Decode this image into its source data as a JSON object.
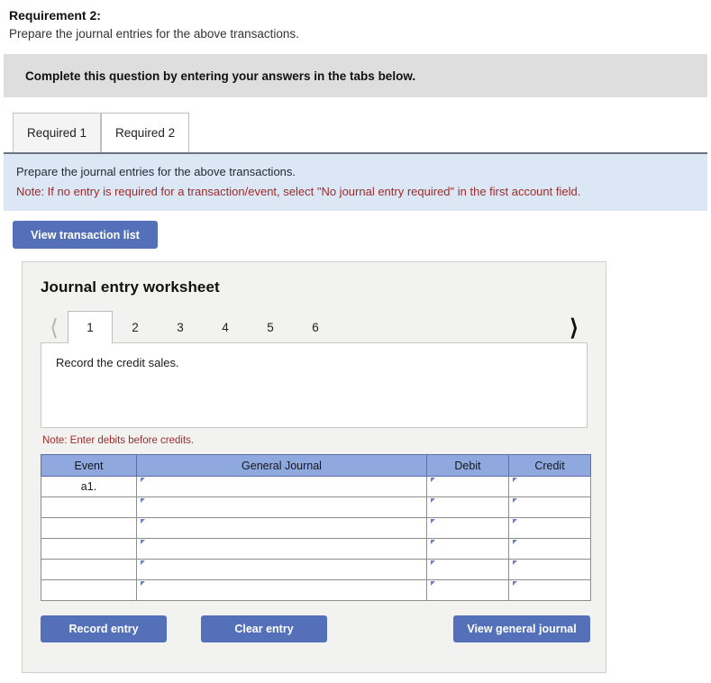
{
  "requirement": {
    "title": "Requirement 2:",
    "subtitle": "Prepare the journal entries for the above transactions."
  },
  "instruction_bar": {
    "text": "Complete this question by entering your answers in the tabs below."
  },
  "tabs": [
    {
      "label": "Required 1",
      "active": false
    },
    {
      "label": "Required 2",
      "active": true
    }
  ],
  "note_panel": {
    "line1": "Prepare the journal entries for the above transactions.",
    "line2": "Note: If no entry is required for a transaction/event, select \"No journal entry required\" in the first account field."
  },
  "view_transaction_list_button": "View transaction list",
  "worksheet": {
    "title": "Journal entry worksheet",
    "prev_icon": "chevron-left-icon",
    "next_icon": "chevron-right-icon",
    "pages": [
      {
        "label": "1",
        "active": true
      },
      {
        "label": "2",
        "active": false
      },
      {
        "label": "3",
        "active": false
      },
      {
        "label": "4",
        "active": false
      },
      {
        "label": "5",
        "active": false
      },
      {
        "label": "6",
        "active": false
      }
    ],
    "description": "Record the credit sales.",
    "debits_note": "Note: Enter debits before credits.",
    "table": {
      "headers": [
        "Event",
        "General Journal",
        "Debit",
        "Credit"
      ],
      "rows": [
        {
          "event": "a1.",
          "general_journal": "",
          "debit": "",
          "credit": ""
        },
        {
          "event": "",
          "general_journal": "",
          "debit": "",
          "credit": ""
        },
        {
          "event": "",
          "general_journal": "",
          "debit": "",
          "credit": ""
        },
        {
          "event": "",
          "general_journal": "",
          "debit": "",
          "credit": ""
        },
        {
          "event": "",
          "general_journal": "",
          "debit": "",
          "credit": ""
        },
        {
          "event": "",
          "general_journal": "",
          "debit": "",
          "credit": ""
        }
      ]
    },
    "buttons": {
      "record": "Record entry",
      "clear": "Clear entry",
      "view_general_journal": "View general journal"
    }
  },
  "colors": {
    "button_blue": "#5470b8",
    "table_header_blue": "#8fa8de",
    "note_panel_blue": "#dbe7f4",
    "note_text_red": "#9e2b2b",
    "instruction_bar_grey": "#dedede",
    "worksheet_bg": "#f2f2f1"
  }
}
